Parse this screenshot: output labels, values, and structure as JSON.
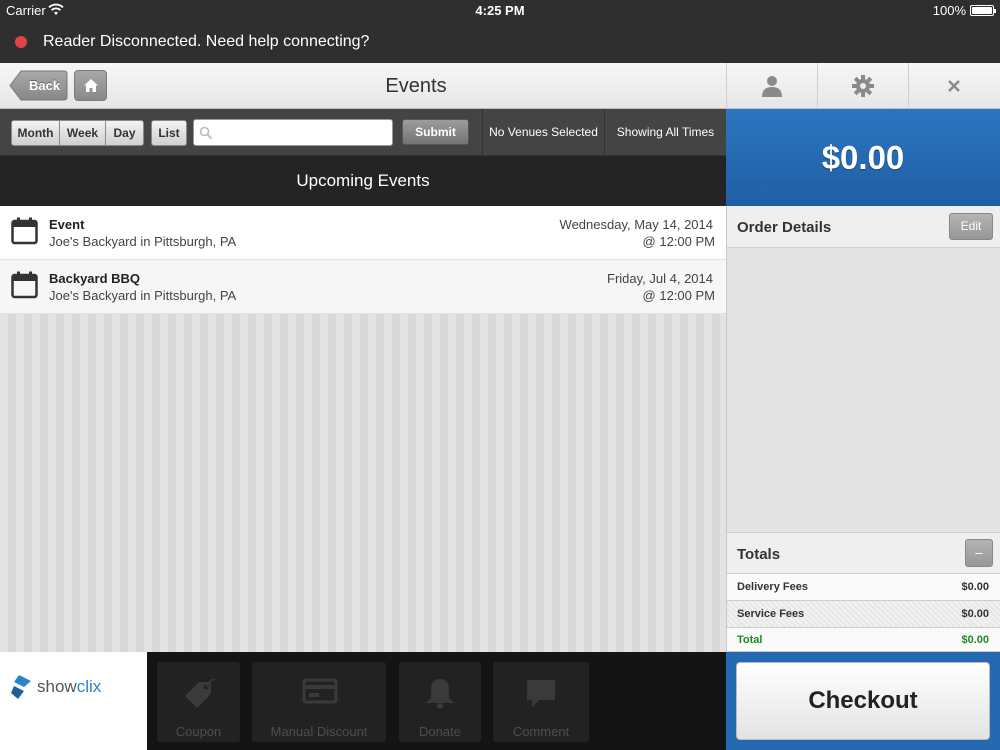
{
  "status_bar": {
    "carrier": "Carrier",
    "time": "4:25 PM",
    "battery": "100%"
  },
  "alert": {
    "message": "Reader Disconnected. Need help connecting?",
    "color": "#e04545"
  },
  "nav": {
    "back_label": "Back",
    "title": "Events"
  },
  "top_right": {
    "icons": [
      "user-icon",
      "gear-icon",
      "close-icon"
    ]
  },
  "toolbar": {
    "segments": [
      "Month",
      "Week",
      "Day"
    ],
    "list_label": "List",
    "search_value": "",
    "submit_label": "Submit",
    "venue_filter": "No Venues Selected",
    "time_filter": "Showing All Times"
  },
  "section_title": "Upcoming Events",
  "events": [
    {
      "name": "Event",
      "venue": "Joe's Backyard in Pittsburgh, PA",
      "date": "Wednesday, May 14, 2014",
      "time": "@ 12:00 PM"
    },
    {
      "name": "Backyard BBQ",
      "venue": "Joe's Backyard in Pittsburgh, PA",
      "date": "Friday, Jul 4, 2014",
      "time": "@ 12:00 PM"
    }
  ],
  "brand": {
    "name_part1": "show",
    "name_part2": "clix"
  },
  "actions": [
    "Coupon",
    "Manual Discount",
    "Donate",
    "Comment"
  ],
  "order": {
    "amount": "$0.00",
    "details_title": "Order Details",
    "edit_label": "Edit",
    "totals_title": "Totals",
    "collapse_label": "–",
    "fees": [
      {
        "label": "Delivery Fees",
        "value": "$0.00"
      },
      {
        "label": "Service Fees",
        "value": "$0.00"
      }
    ],
    "total": {
      "label": "Total",
      "value": "$0.00"
    },
    "checkout_label": "Checkout"
  },
  "colors": {
    "accent": "#2569b2",
    "total_green": "#1f8a1f"
  }
}
